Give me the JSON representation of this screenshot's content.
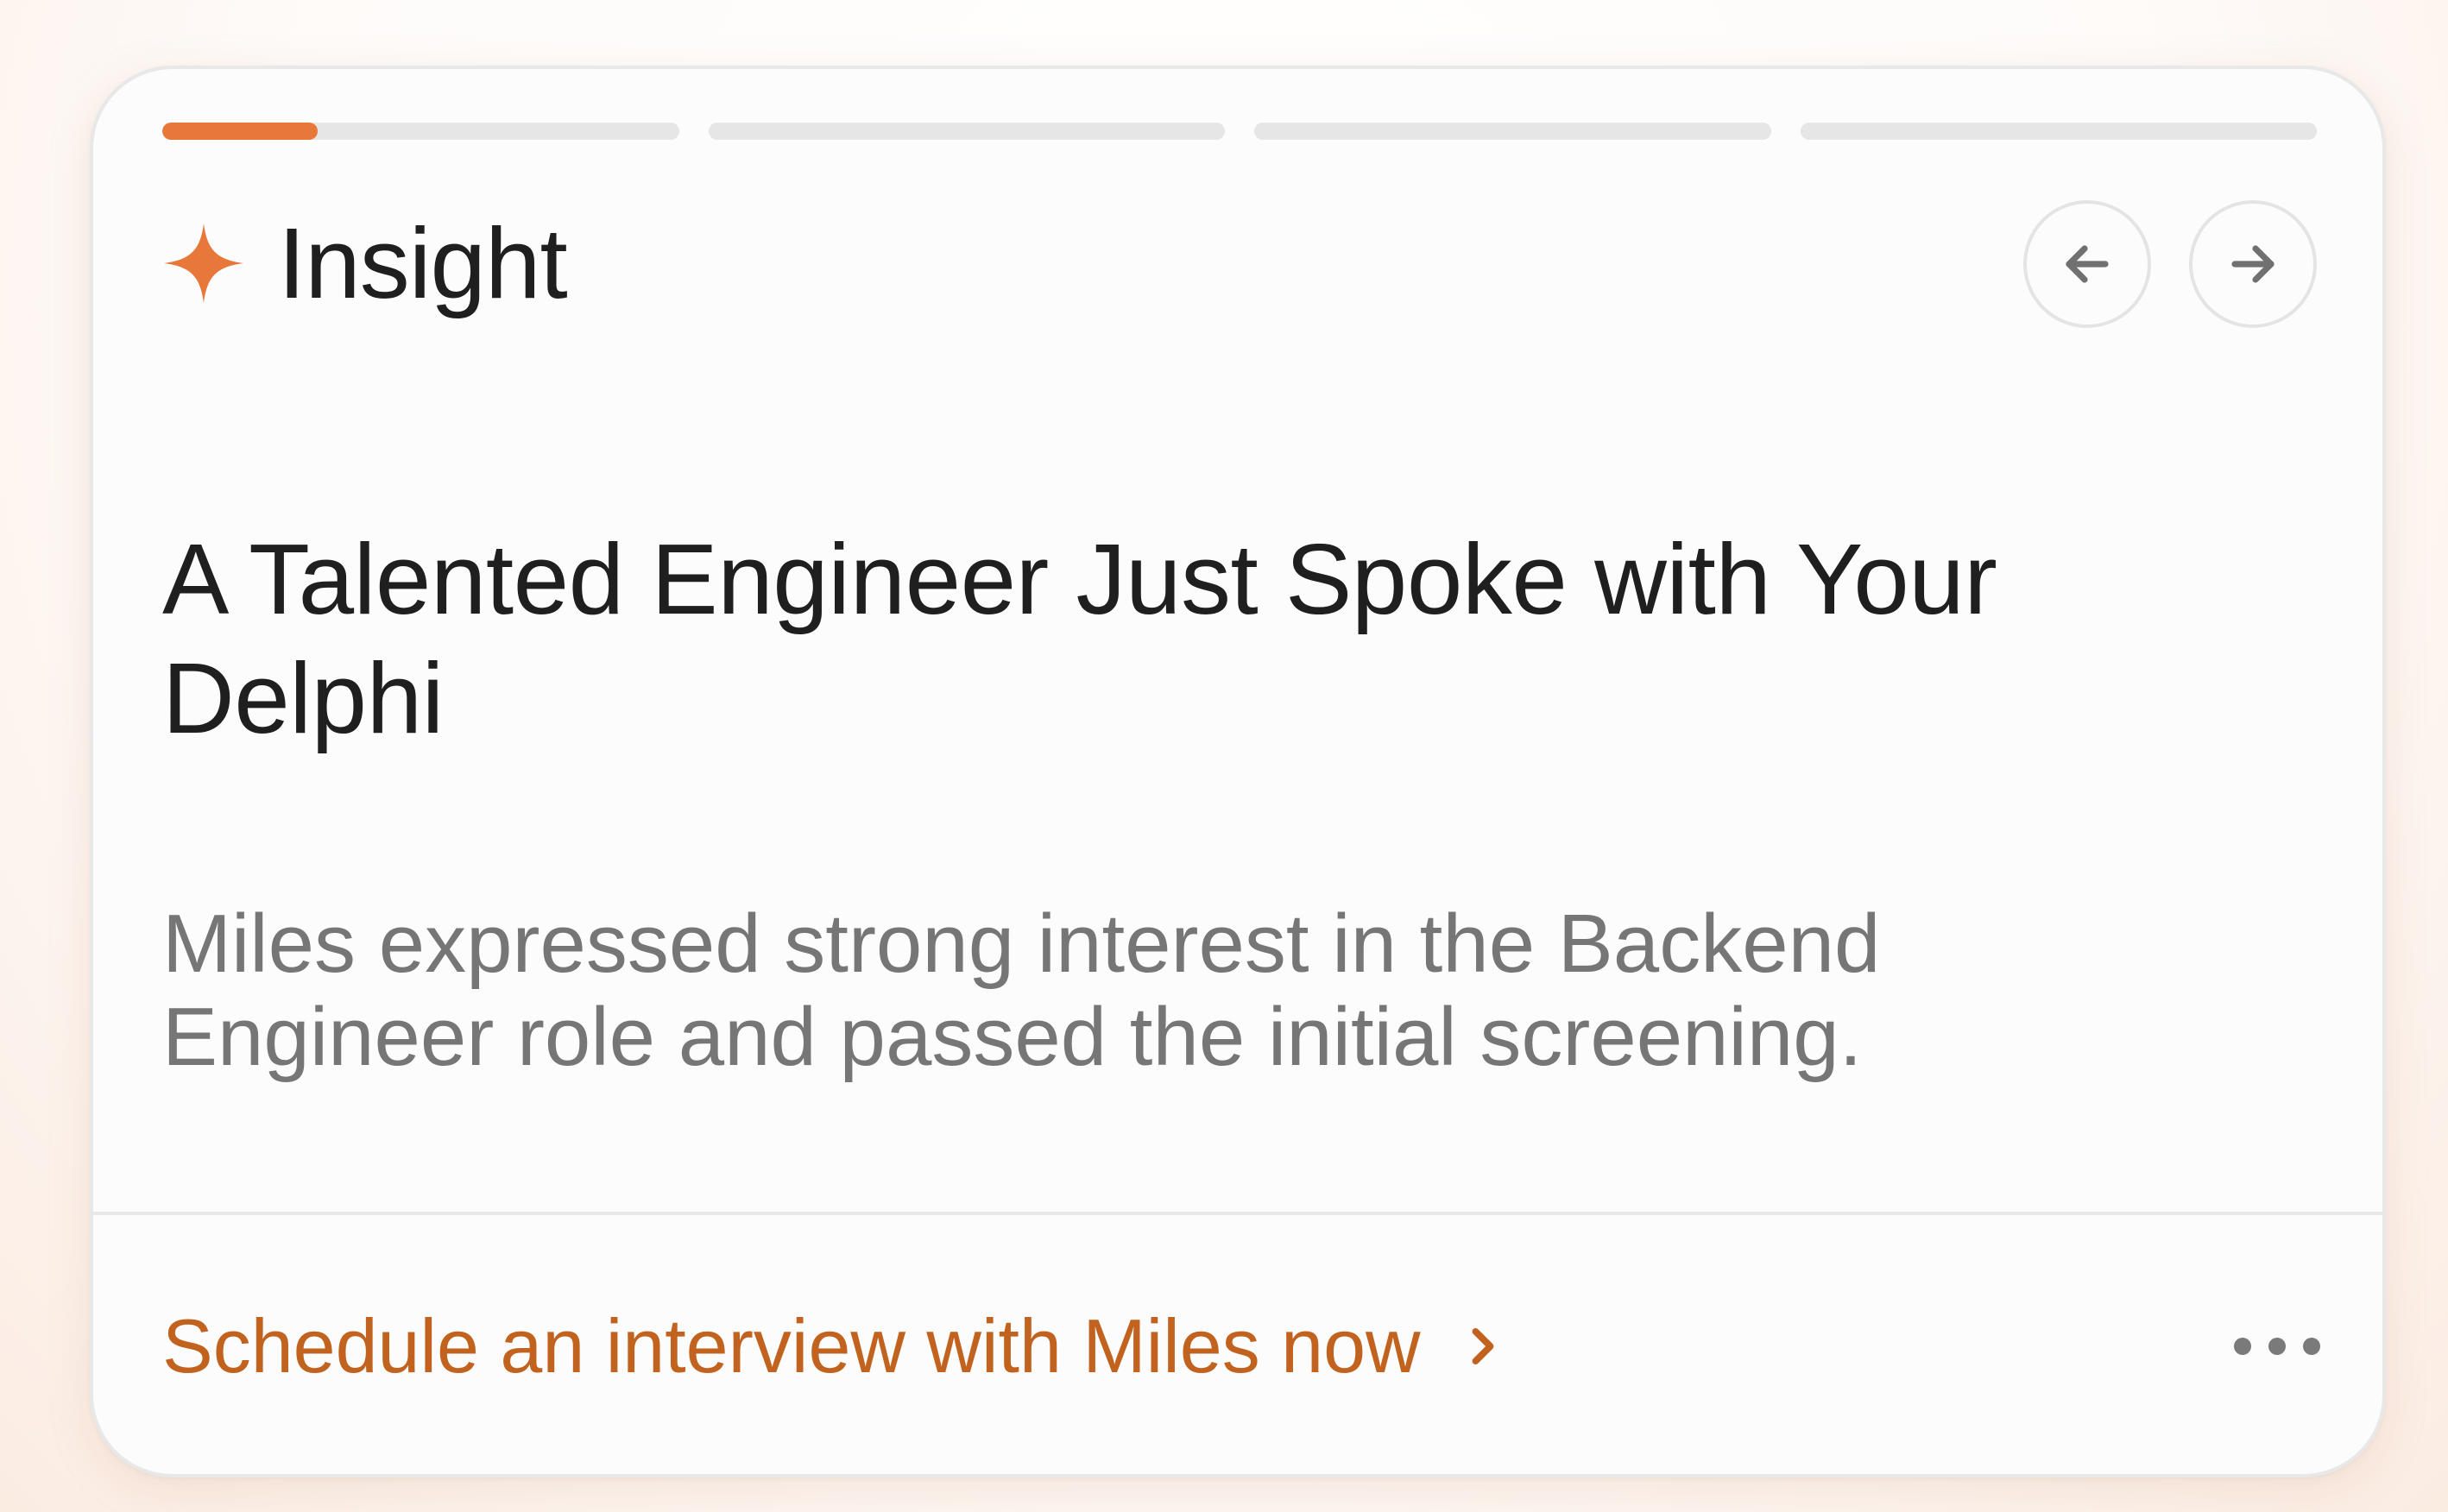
{
  "card": {
    "progress": {
      "segments": 4,
      "active_segment": 1,
      "active_fill_fraction": 0.3,
      "accent_color": "#e8783a",
      "track_color": "#e6e6e6"
    },
    "header": {
      "icon": "sparkle-icon",
      "title": "Insight"
    },
    "nav": {
      "prev_icon": "arrow-left-icon",
      "next_icon": "arrow-right-icon"
    },
    "headline": "A Talented Engineer Just Spoke with Your Delphi",
    "description": "Miles expressed strong interest in the Backend Engineer role and passed the initial screening.",
    "footer": {
      "cta_label": "Schedule an interview with Miles now",
      "cta_color": "#c2621f",
      "cta_icon": "chevron-right-icon",
      "more_icon": "more-horizontal-icon"
    }
  }
}
